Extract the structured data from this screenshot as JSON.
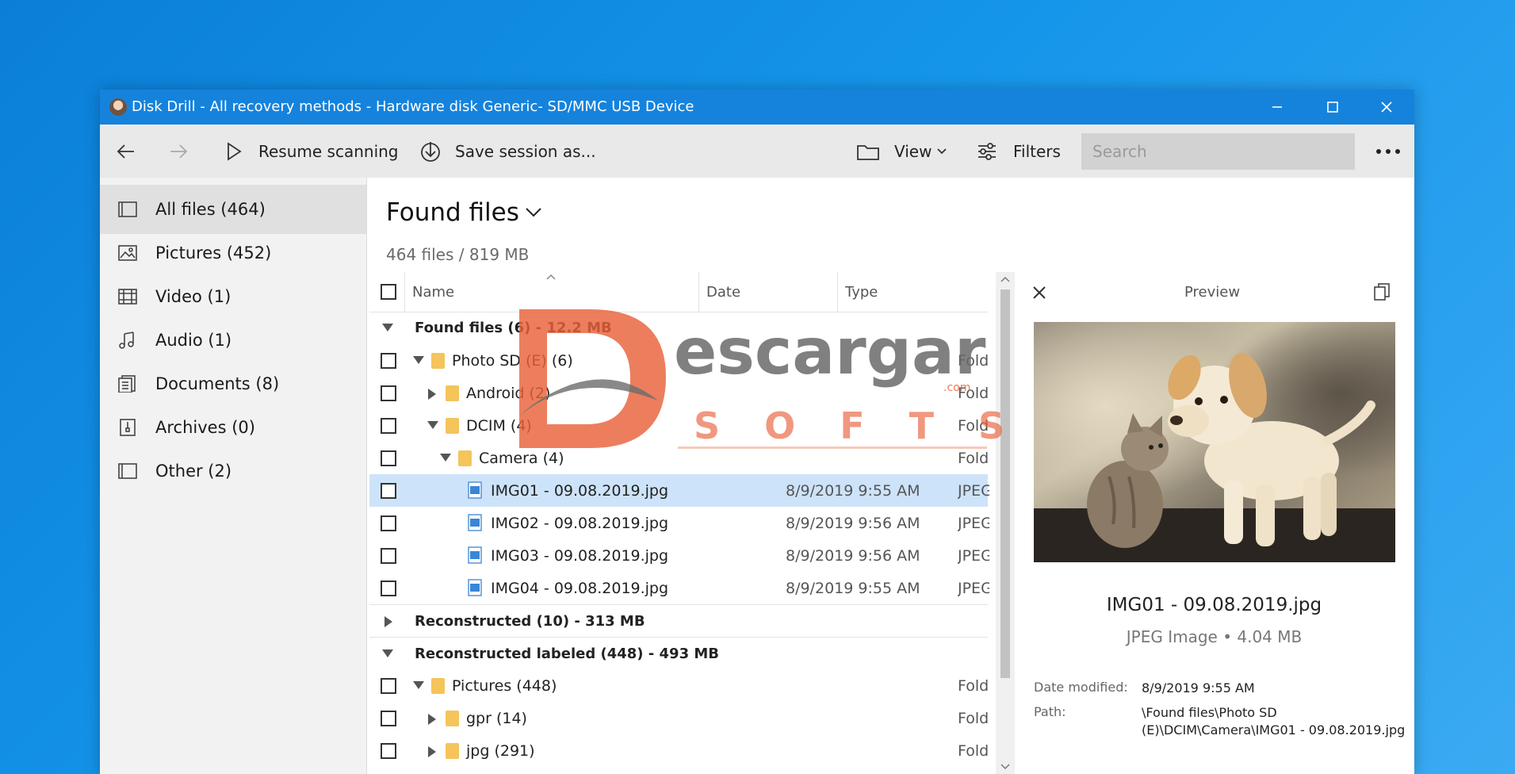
{
  "window": {
    "title": "Disk Drill - All recovery methods - Hardware disk Generic- SD/MMC USB Device"
  },
  "toolbar": {
    "resume_label": "Resume scanning",
    "save_label": "Save session as...",
    "view_label": "View",
    "filters_label": "Filters",
    "search_placeholder": "Search"
  },
  "sidebar": {
    "items": [
      {
        "label": "All files (464)",
        "icon": "all-files-icon"
      },
      {
        "label": "Pictures (452)",
        "icon": "pictures-icon"
      },
      {
        "label": "Video (1)",
        "icon": "video-icon"
      },
      {
        "label": "Audio (1)",
        "icon": "audio-icon"
      },
      {
        "label": "Documents (8)",
        "icon": "documents-icon"
      },
      {
        "label": "Archives (0)",
        "icon": "archives-icon"
      },
      {
        "label": "Other (2)",
        "icon": "other-icon"
      }
    ]
  },
  "main": {
    "title": "Found files",
    "summary": "464 files / 819 MB",
    "columns": {
      "name": "Name",
      "date": "Date",
      "type": "Type"
    },
    "rows": [
      {
        "name": "Found files (6) - 12.2 MB"
      },
      {
        "name": "Photo SD (E) (6)",
        "type": "Folder"
      },
      {
        "name": "Android (2)",
        "type": "Folder"
      },
      {
        "name": "DCIM (4)",
        "type": "Folder"
      },
      {
        "name": "Camera (4)",
        "type": "Folder"
      },
      {
        "name": "IMG01 - 09.08.2019.jpg",
        "date": "8/9/2019 9:55 AM",
        "type": "JPEG Image"
      },
      {
        "name": "IMG02 - 09.08.2019.jpg",
        "date": "8/9/2019 9:56 AM",
        "type": "JPEG Image"
      },
      {
        "name": "IMG03 - 09.08.2019.jpg",
        "date": "8/9/2019 9:56 AM",
        "type": "JPEG Image"
      },
      {
        "name": "IMG04 - 09.08.2019.jpg",
        "date": "8/9/2019 9:55 AM",
        "type": "JPEG Image"
      },
      {
        "name": "Reconstructed (10) - 313 MB"
      },
      {
        "name": "Reconstructed labeled (448) - 493 MB"
      },
      {
        "name": "Pictures (448)",
        "type": "Folder"
      },
      {
        "name": "gpr (14)",
        "type": "Folder"
      },
      {
        "name": "jpg (291)",
        "type": "Folder"
      }
    ]
  },
  "preview": {
    "title": "Preview",
    "file_name": "IMG01 - 09.08.2019.jpg",
    "file_meta": "JPEG Image • 4.04 MB",
    "date_label": "Date modified:",
    "date_value": "8/9/2019 9:55 AM",
    "path_label": "Path:",
    "path_value": "\\Found files\\Photo SD (E)\\DCIM\\Camera\\IMG01 - 09.08.2019.jpg"
  },
  "watermark": {
    "line1": "escargar",
    "line2": "SOFTS",
    "domain": ".com"
  },
  "colors": {
    "titlebar": "#1583dc",
    "selection": "#cde3f9",
    "folder": "#f5c45a",
    "watermark": "#e8613a"
  }
}
